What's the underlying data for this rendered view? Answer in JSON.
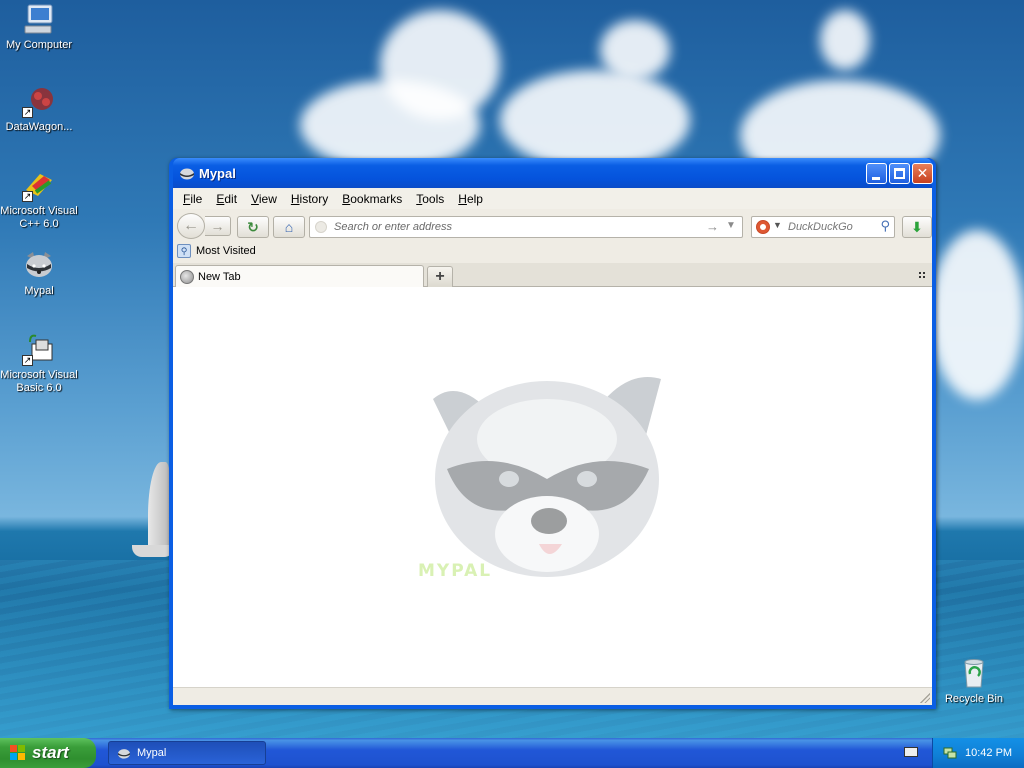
{
  "desktop": {
    "icons": [
      {
        "label": "My Computer"
      },
      {
        "label": "DataWagon..."
      },
      {
        "label": "Microsoft Visual C++ 6.0"
      },
      {
        "label": "Mypal"
      },
      {
        "label": "Microsoft Visual Basic 6.0"
      },
      {
        "label": "Recycle Bin"
      }
    ]
  },
  "window": {
    "title": "Mypal",
    "menu": [
      "File",
      "Edit",
      "View",
      "History",
      "Bookmarks",
      "Tools",
      "Help"
    ],
    "menu_mnemonics": [
      "F",
      "E",
      "V",
      "H",
      "B",
      "T",
      "H"
    ],
    "address_placeholder": "Search or enter address",
    "search_placeholder": "DuckDuckGo",
    "bookmarks": [
      {
        "label": "Most Visited"
      }
    ],
    "tabs": [
      {
        "label": "New Tab"
      }
    ],
    "watermark": "MYPAL"
  },
  "taskbar": {
    "start_label": "start",
    "tasks": [
      {
        "label": "Mypal"
      }
    ],
    "clock": "10:42 PM"
  },
  "colors": {
    "titlebar": "#0a5ee4",
    "taskbar": "#2157d7",
    "start": "#3a9e3a",
    "tray": "#0f7fd6"
  }
}
